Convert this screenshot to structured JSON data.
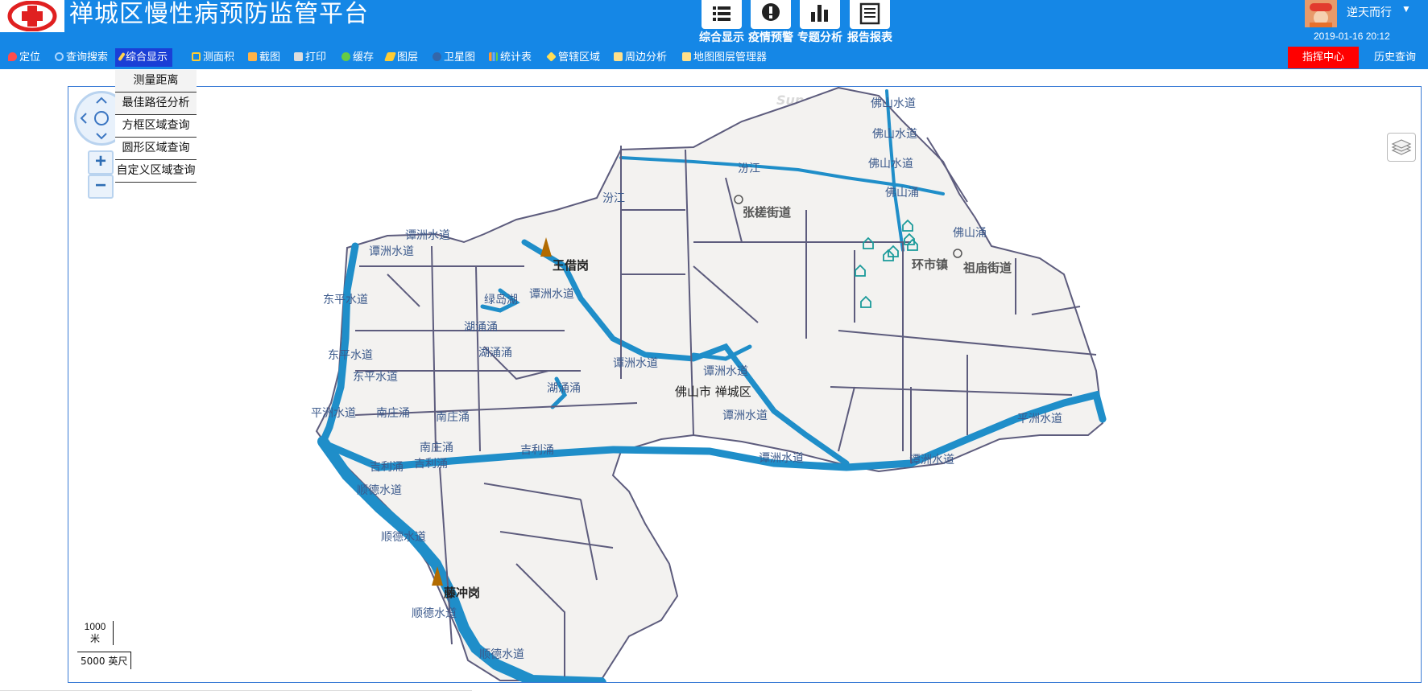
{
  "header": {
    "title": "禅城区慢性病预防监管平台",
    "modules": [
      {
        "label": "综合显示",
        "icon": "list-icon"
      },
      {
        "label": "疫情预警",
        "icon": "alert-icon"
      },
      {
        "label": "专题分析",
        "icon": "bar-chart-icon"
      },
      {
        "label": "报告报表",
        "icon": "report-icon"
      }
    ],
    "user_name": "逆天而行",
    "datetime": "2019-01-16 20:12"
  },
  "toolbar": {
    "items": [
      {
        "label": "定位",
        "icon": "pin-icon",
        "color": "#ff4d4d"
      },
      {
        "label": "查询搜索",
        "icon": "search-icon",
        "color": "#a8d4ff"
      },
      {
        "label": "综合显示",
        "icon": "pencil-icon",
        "color": "#ffd24d",
        "active": true
      },
      {
        "label": "测面积",
        "icon": "area-icon",
        "color": "#ffcc33"
      },
      {
        "label": "截图",
        "icon": "picture-icon",
        "color": "#ffb347"
      },
      {
        "label": "打印",
        "icon": "printer-icon",
        "color": "#dddddd"
      },
      {
        "label": "缓存",
        "icon": "recycle-icon",
        "color": "#66cc44"
      },
      {
        "label": "图层",
        "icon": "layers-icon",
        "color": "#ffcc33"
      },
      {
        "label": "卫星图",
        "icon": "globe-icon",
        "color": "#3366aa"
      },
      {
        "label": "统计表",
        "icon": "stats-icon",
        "color": "#ff9933"
      },
      {
        "label": "管辖区域",
        "icon": "diamond-icon",
        "color": "#ffdd55"
      },
      {
        "label": "周边分析",
        "icon": "map-icon",
        "color": "#ffe08a"
      },
      {
        "label": "地图图层管理器",
        "icon": "map-layers-icon",
        "color": "#ffe08a"
      }
    ],
    "command_center": "指挥中心",
    "history_query": "历史查询",
    "command_color": "#ff0000",
    "brand_color": "#1587e6"
  },
  "dropdown": {
    "items": [
      "测量距离",
      "最佳路径分析",
      "方框区域查询",
      "圆形区域查询",
      "自定义区域查询"
    ]
  },
  "map": {
    "watermark": "SuperMap",
    "water_labels": [
      "佛山水道",
      "佛山水道",
      "佛山水道",
      "佛山涌",
      "佛山涌",
      "汾江",
      "汾江",
      "谭洲水道",
      "谭洲水道",
      "谭洲水道",
      "谭洲水道",
      "谭洲水道",
      "谭洲水道",
      "谭洲水道",
      "谭洲水道",
      "东平水道",
      "东平水道",
      "东平水道",
      "平洲水道",
      "平洲水道",
      "南庄涌",
      "南庄涌",
      "南庄涌",
      "吉利涌",
      "吉利涌",
      "吉利涌",
      "湖涌涌",
      "湖涌涌",
      "湖涌涌",
      "绿岛湖",
      "顺德水道",
      "顺德水道",
      "顺德水道",
      "顺德水道"
    ],
    "places": [
      "王借岗",
      "藤冲岗"
    ],
    "towns": [
      "张槎街道",
      "环市镇",
      "祖庙街道"
    ],
    "district": "佛山市 禅城区",
    "scale_metric": "1000\n米",
    "scale_imperial": "5000 英尺",
    "water_color": "#1f8ec9",
    "land_color": "#f3f2f0",
    "road_color": "#5d5c7d",
    "marker_color": "#1a9a9a"
  }
}
